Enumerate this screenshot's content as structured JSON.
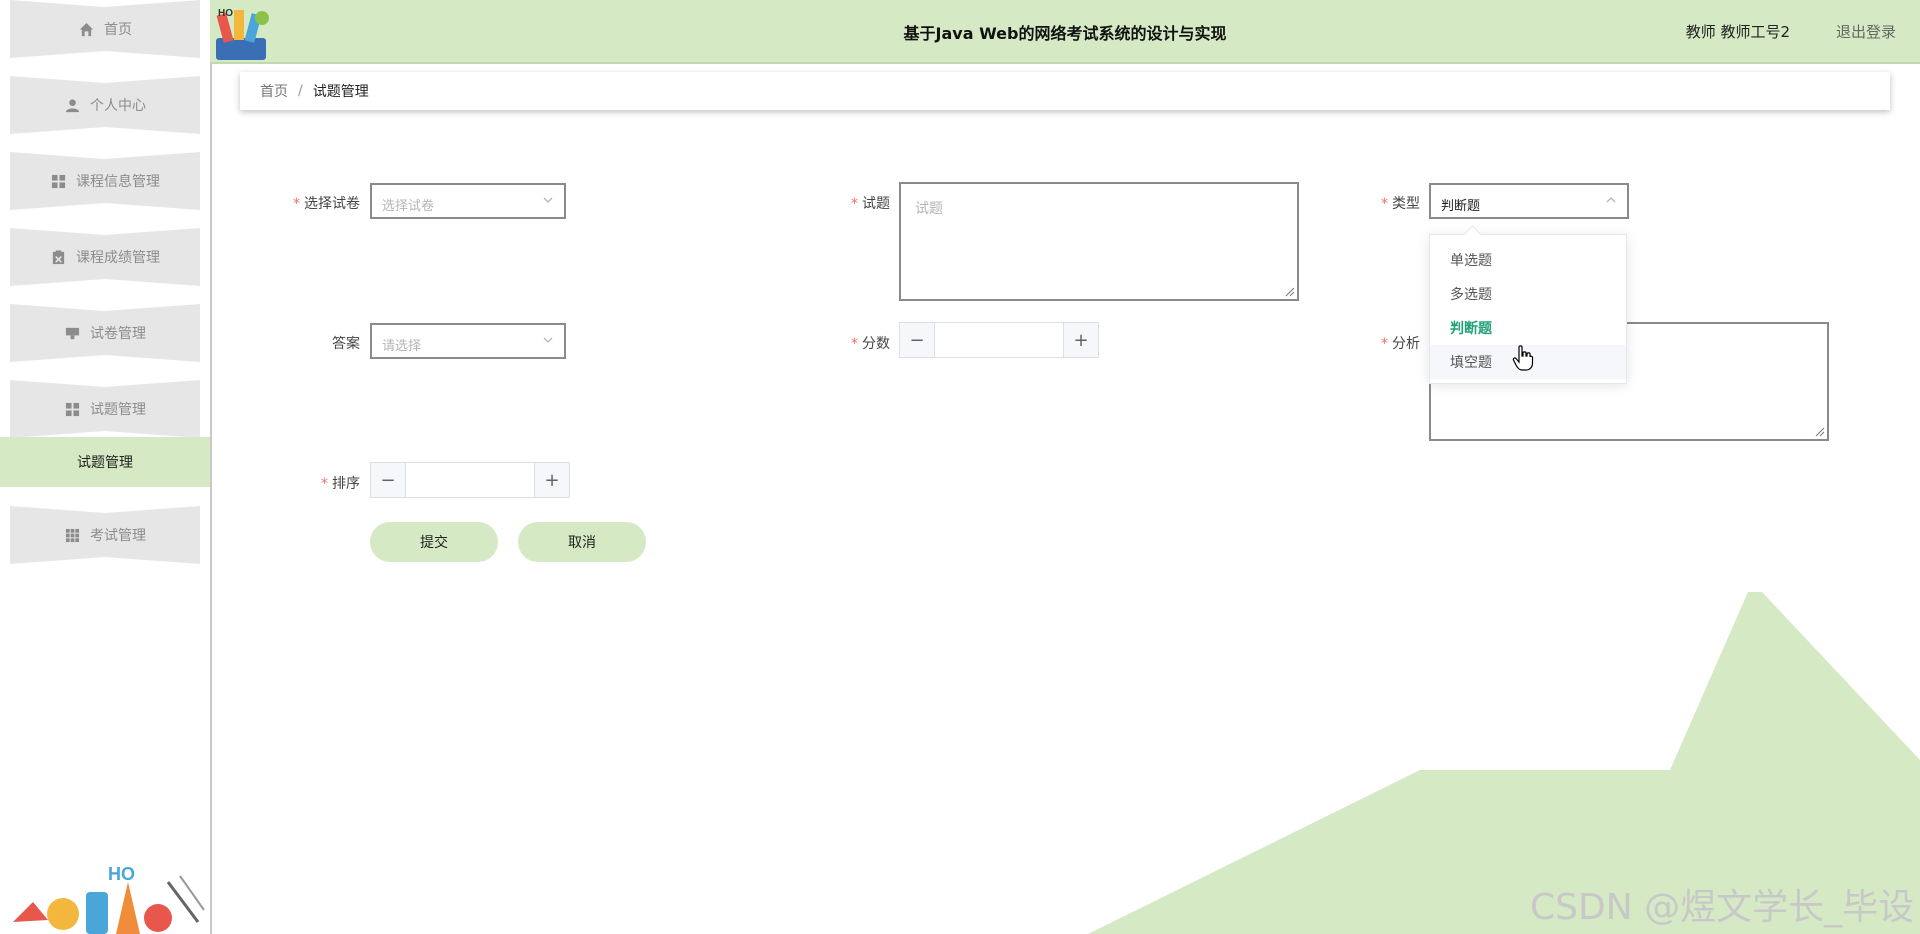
{
  "app": {
    "title": "基于Java Web的网络考试系统的设计与实现",
    "user_label": "教师 教师工号2",
    "logout_label": "退出登录"
  },
  "colors": {
    "accent": "#d5e9c4",
    "selected_option": "#1fa37a",
    "required_mark": "#f56c6c"
  },
  "sidebar": {
    "items": [
      {
        "label": "首页",
        "icon": "home-icon"
      },
      {
        "label": "个人中心",
        "icon": "user-icon"
      },
      {
        "label": "课程信息管理",
        "icon": "grid-icon"
      },
      {
        "label": "课程成绩管理",
        "icon": "clipboard-icon"
      },
      {
        "label": "试卷管理",
        "icon": "monitor-icon"
      },
      {
        "label": "试题管理",
        "icon": "grid-icon"
      },
      {
        "label": "考试管理",
        "icon": "apps-icon"
      }
    ],
    "active_sub_item": "试题管理"
  },
  "breadcrumb": {
    "home": "首页",
    "separator": "/",
    "current": "试题管理"
  },
  "form": {
    "paper": {
      "label": "选择试卷",
      "placeholder": "选择试卷"
    },
    "question": {
      "label": "试题",
      "placeholder": "试题"
    },
    "type": {
      "label": "类型",
      "value": "判断题"
    },
    "answer": {
      "label": "答案",
      "placeholder": "请选择"
    },
    "score": {
      "label": "分数",
      "value": ""
    },
    "analysis": {
      "label": "分析",
      "placeholder": ""
    },
    "order": {
      "label": "排序",
      "value": ""
    },
    "required_mark": "*",
    "minus": "−",
    "plus": "+",
    "submit_label": "提交",
    "cancel_label": "取消"
  },
  "dropdown": {
    "options": [
      "单选题",
      "多选题",
      "判断题",
      "填空题"
    ],
    "selected": "判断题",
    "hovered": "填空题"
  },
  "watermark": "CSDN @煜文学长_毕设"
}
